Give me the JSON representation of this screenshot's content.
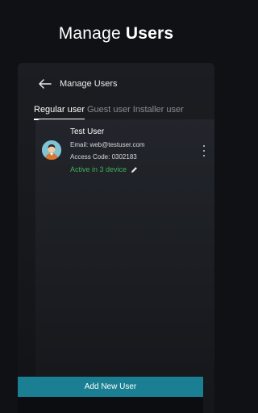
{
  "promo": {
    "title_regular": "Manage ",
    "title_bold": "Users"
  },
  "header": {
    "title": "Manage Users",
    "back_icon": "arrow-left-icon"
  },
  "tabs": [
    {
      "label": "Regular user",
      "active": true
    },
    {
      "label": "Guest user",
      "active": false
    },
    {
      "label": "Installer user",
      "active": false
    }
  ],
  "users": [
    {
      "name": "Test User",
      "email": "Email: web@testuser.com",
      "access_code": "Access Code: 0302183",
      "status": "Active in 3 device",
      "status_color": "#3fae5c",
      "avatar_icon": "user-avatar-icon",
      "edit_icon": "pencil-icon",
      "menu_icon": "more-vertical-icon"
    }
  ],
  "add_button": {
    "label": "Add New User",
    "color": "#1a7f93"
  },
  "colors": {
    "background": "#0f1114",
    "panel": "#1b1d22",
    "accent": "#1a7f93"
  }
}
